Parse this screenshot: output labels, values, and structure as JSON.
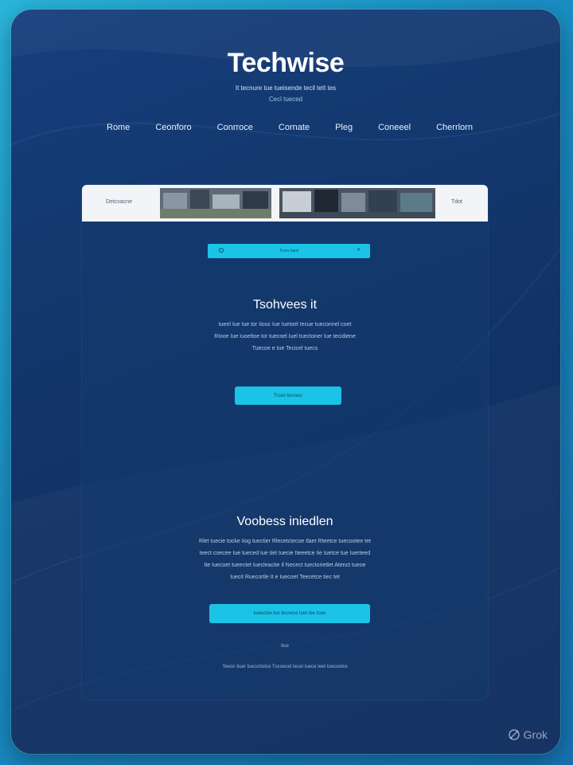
{
  "brand": {
    "name": "Techwise",
    "tagline": "It tecnure tue tueisende tecil teIt tes",
    "subtagline": "Cecl tueced"
  },
  "nav": {
    "items": [
      "Rome",
      "Ceonforo",
      "Conrroce",
      "Cornate",
      "Pleg",
      "Coneeel",
      "Cherrlorn"
    ]
  },
  "strip": {
    "left_label": "Detcvacne",
    "right_label": "Tdot"
  },
  "banner": {
    "label": "Trceo tacel"
  },
  "section1": {
    "heading": "Tsohvees it",
    "lines": [
      "tueel Iue tue tor Iiooc Iue Iuetoel Iecue  tueconnel coet",
      "Riooe Iue Iuoeltoe tor tuecoel Iuel tuectoner Iue tecidiene",
      "Tuecoe e tue Tecicel tuecs"
    ],
    "button": "Trceo tecoecr"
  },
  "section2": {
    "heading": "Voobess iniedlen",
    "lines": [
      "Rlet tuecie tocke Iiog tuectier Rlecetctecoe tlaet Rteetce  tuecootee tet",
      "teect coecee  Iue  tueced Iue  tiet Iuecie Iteeetce Iie Iuetce tue Iuerteed",
      "Ite Iuecoet tueectet Iuecleacite Il Necect tuectorietlet Atenct tueoe",
      "Iuecit  Ruecortle It e Iuecoet Teecetce tiec tet"
    ],
    "button": "tueectoe tue tecnece tuet tee tooe",
    "small_text": "Iiue",
    "footer_text": "Teeon  Iiuer tuecortotce  Tucoecet  Iecet  Iuece  Ieet tuecoetce"
  },
  "watermark": "Grok",
  "colors": {
    "accent": "#1bc3e6",
    "background": "#123468",
    "outer": "#2bb6dc"
  }
}
